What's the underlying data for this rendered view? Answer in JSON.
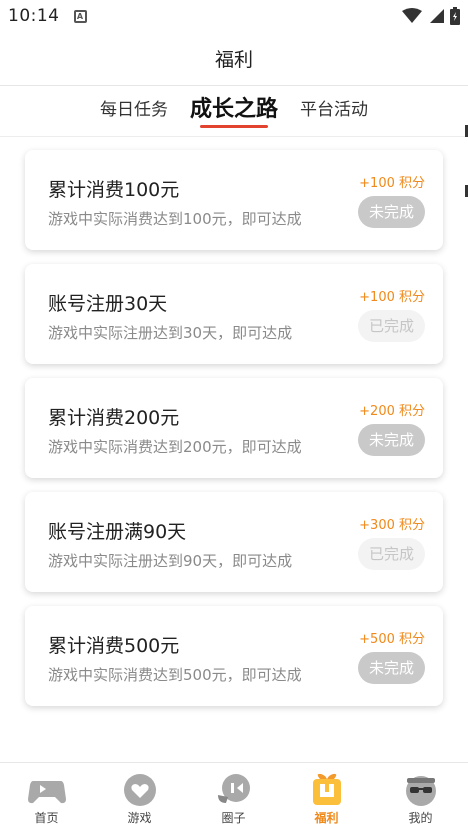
{
  "status_bar": {
    "time": "10:14",
    "notif_glyph": "A"
  },
  "header": {
    "title": "福利"
  },
  "tabs": [
    {
      "label": "每日任务",
      "active": false
    },
    {
      "label": "成长之路",
      "active": true
    },
    {
      "label": "平台活动",
      "active": false
    }
  ],
  "tasks": [
    {
      "title": "累计消费100元",
      "desc": "游戏中实际消费达到100元，即可达成",
      "points": "+100 积分",
      "status": "未完成"
    },
    {
      "title": "账号注册30天",
      "desc": "游戏中实际注册达到30天，即可达成",
      "points": "+100 积分",
      "status": "已完成"
    },
    {
      "title": "累计消费200元",
      "desc": "游戏中实际消费达到200元，即可达成",
      "points": "+200 积分",
      "status": "未完成"
    },
    {
      "title": "账号注册满90天",
      "desc": "游戏中实际注册达到90天，即可达成",
      "points": "+300 积分",
      "status": "已完成"
    },
    {
      "title": "累计消费500元",
      "desc": "游戏中实际消费达到500元，即可达成",
      "points": "+500 积分",
      "status": "未完成"
    }
  ],
  "bottom_nav": [
    {
      "label": "首页",
      "icon": "home-gamepad-icon",
      "active": false
    },
    {
      "label": "游戏",
      "icon": "game-heart-icon",
      "active": false
    },
    {
      "label": "圈子",
      "icon": "circle-chat-icon",
      "active": false
    },
    {
      "label": "福利",
      "icon": "gift-icon",
      "active": true
    },
    {
      "label": "我的",
      "icon": "profile-sunglasses-icon",
      "active": false
    }
  ],
  "colors": {
    "accent": "#f08a1c",
    "tab_underline": "#e2432e",
    "pending_badge": "#c9c9c9",
    "done_badge": "#f3f3f3",
    "nav_icon_gray": "#a9a9a9"
  }
}
